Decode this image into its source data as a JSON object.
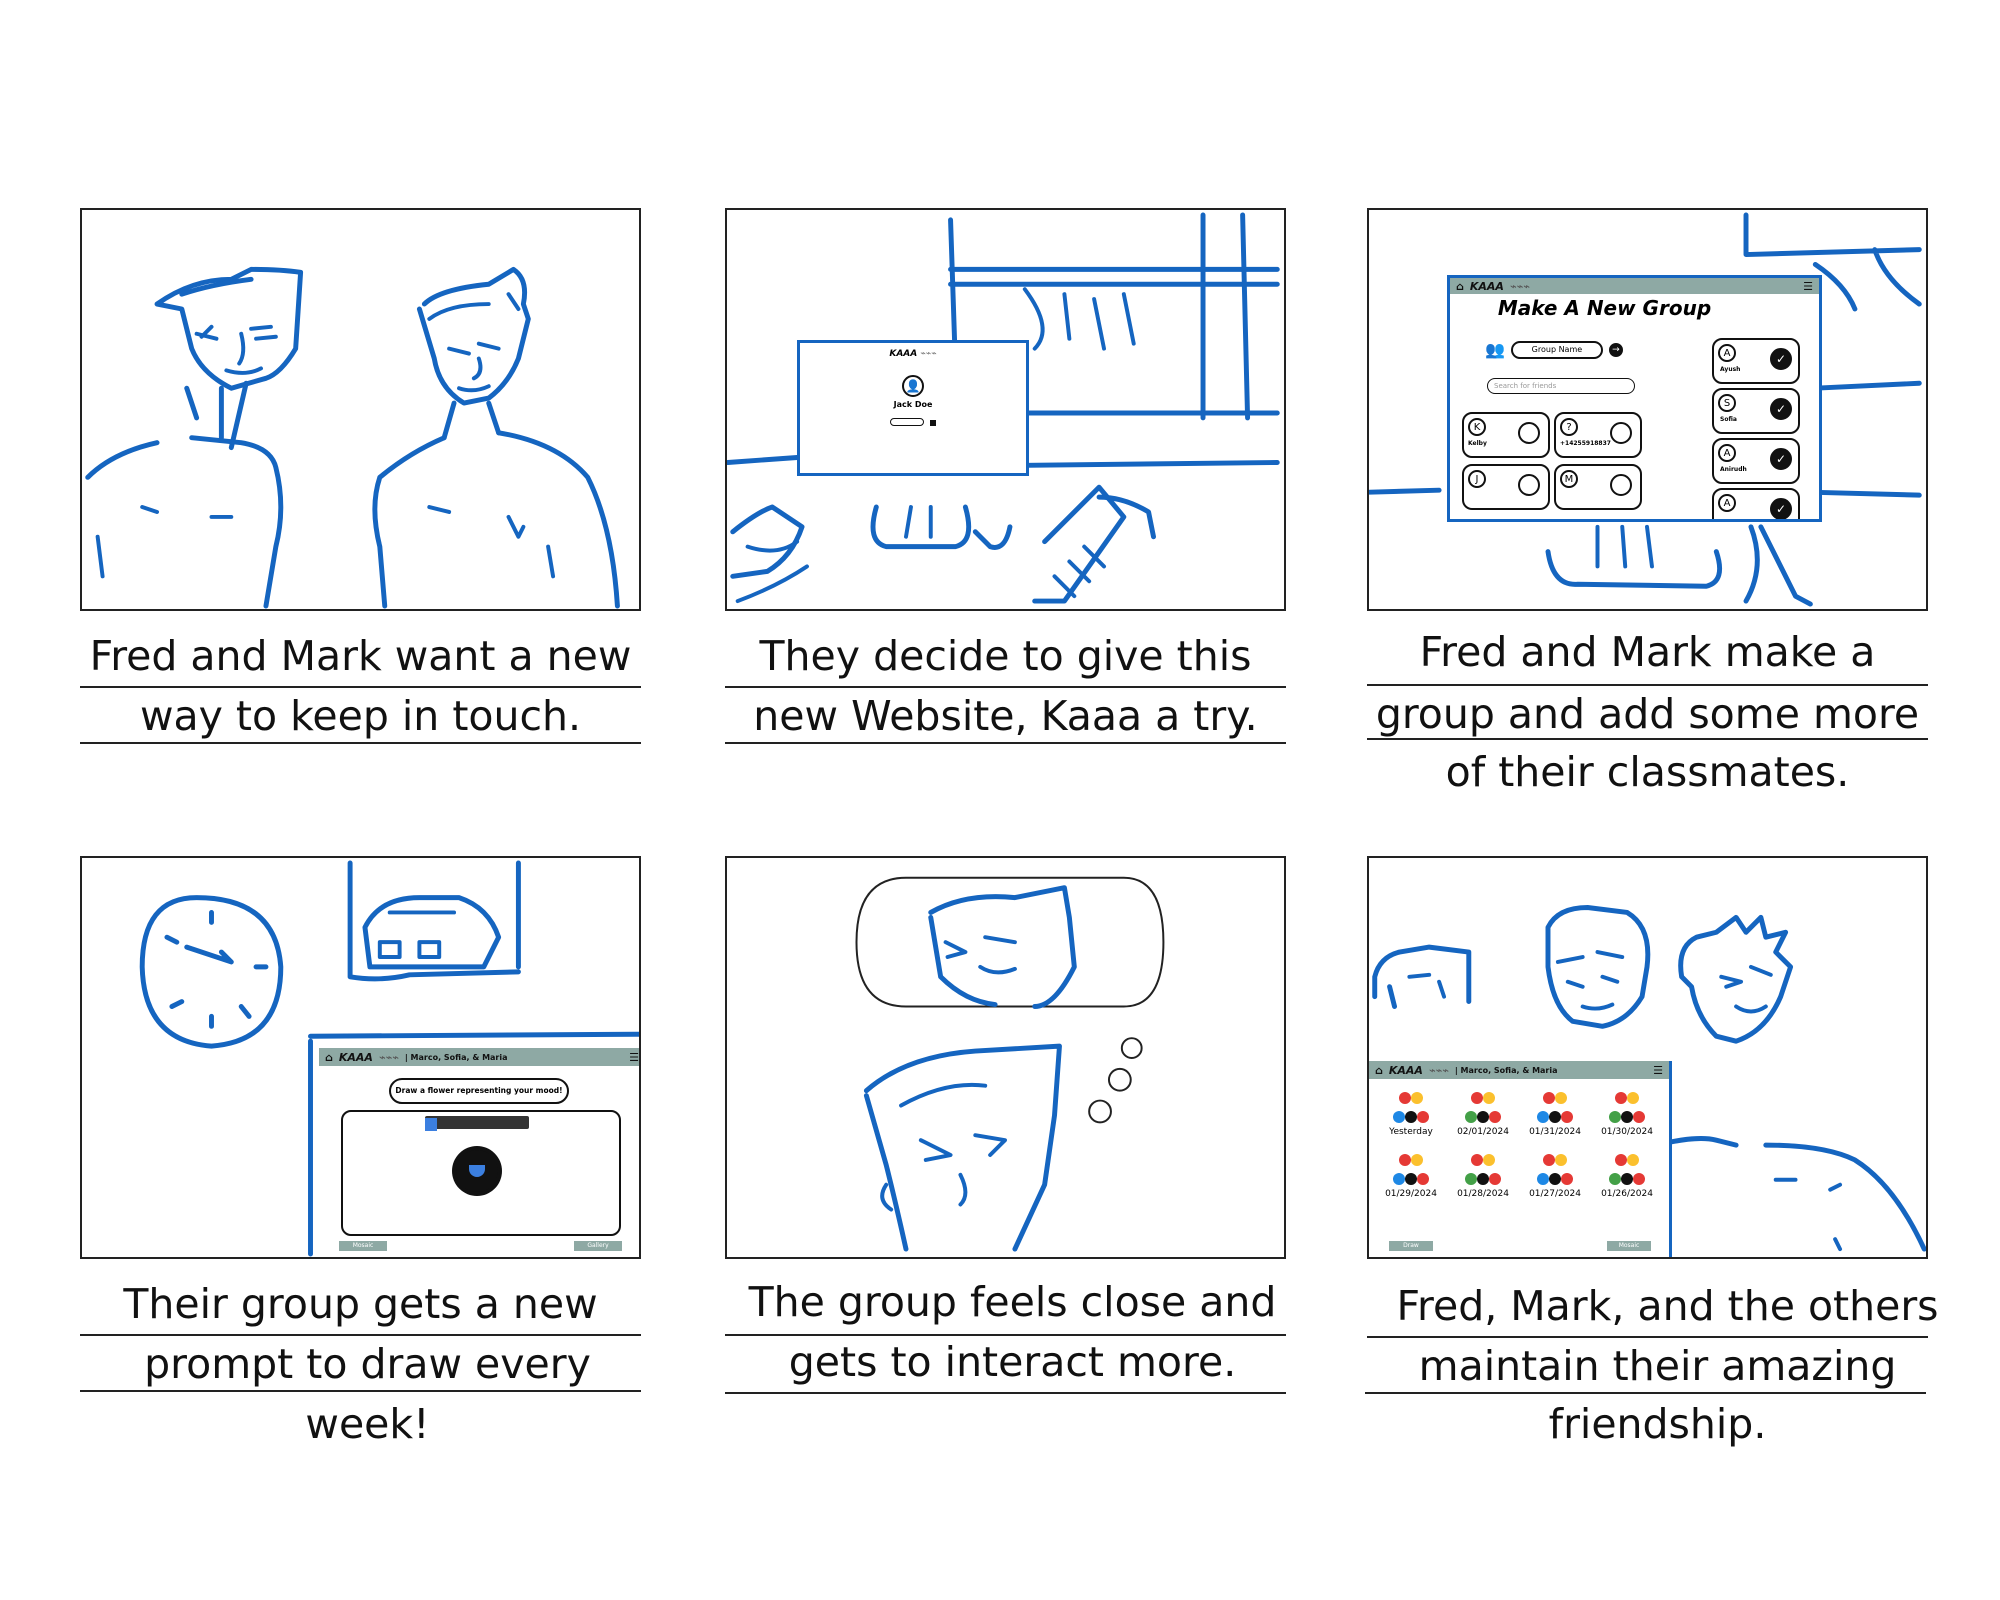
{
  "panels": [
    {
      "caption_line1": "Fred and Mark want a new",
      "caption_line2": "way to keep in touch."
    },
    {
      "caption_line1": "They decide to give this",
      "caption_line2": "new Website, Kaaa a try."
    },
    {
      "caption_line1": "Fred and Mark make a",
      "caption_line2": "group and add some more",
      "caption_line3": "of their classmates."
    },
    {
      "caption_line1": "Their group gets a new",
      "caption_line2": "prompt to draw every week!"
    },
    {
      "caption_line1": "The group feels close and",
      "caption_line2": "gets to interact more."
    },
    {
      "caption_line1": "Fred, Mark, and the others",
      "caption_line2": "maintain their amazing",
      "caption_line3": "friendship."
    }
  ],
  "login_mock": {
    "brand": "KAAA",
    "user_name": "Jack Doe"
  },
  "group_mock": {
    "brand": "KAAA",
    "title": "Make A New Group",
    "group_name_label": "Group Name",
    "search_placeholder": "Search for friends",
    "friends_left": [
      {
        "initial": "K",
        "name": "Kelby"
      },
      {
        "initial": "",
        "name": "+14255918837"
      },
      {
        "initial": "J",
        "name": ""
      },
      {
        "initial": "M",
        "name": ""
      }
    ],
    "friends_right": [
      {
        "initial": "A",
        "name": "Ayush"
      },
      {
        "initial": "S",
        "name": "Sofia"
      },
      {
        "initial": "A",
        "name": "Anirudh"
      },
      {
        "initial": "A",
        "name": ""
      }
    ]
  },
  "draw_mock": {
    "brand": "KAAA",
    "group": "| Marco, Sofia, & Maria",
    "prompt": "Draw a flower representing your mood!",
    "left_button": "Mosaic",
    "right_button": "Gallery"
  },
  "gallery_mock": {
    "brand": "KAAA",
    "group": "| Marco, Sofia, & Maria",
    "dates": [
      "Yesterday",
      "02/01/2024",
      "01/31/2024",
      "01/30/2024",
      "01/29/2024",
      "01/28/2024",
      "01/27/2024",
      "01/26/2024"
    ],
    "left_button": "Draw",
    "right_button": "Mosaic"
  },
  "colors": {
    "sketch": "#1565c0",
    "header": "#8ea9a4"
  }
}
